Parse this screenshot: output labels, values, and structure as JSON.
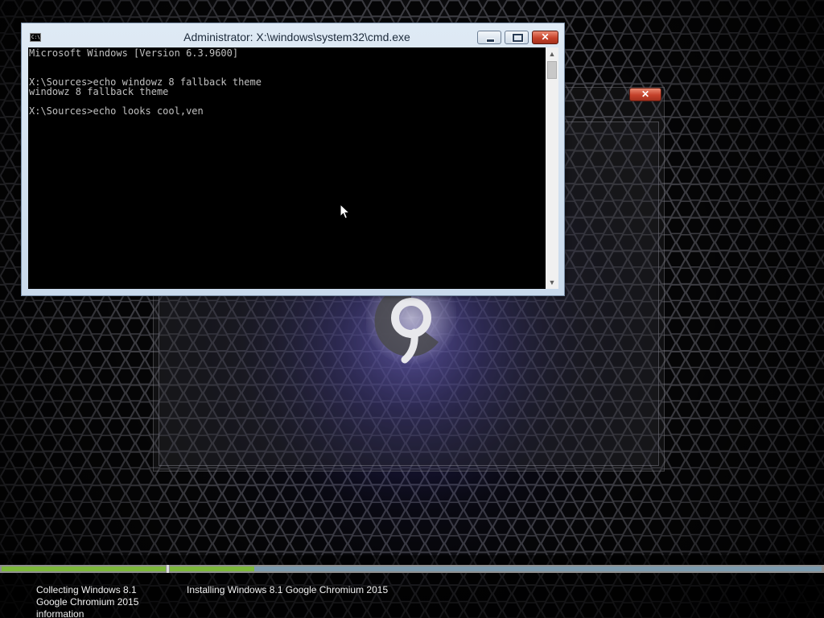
{
  "cmd_window": {
    "title": "Administrator: X:\\windows\\system32\\cmd.exe",
    "icon": "cmd-icon",
    "icon_text": "C:\\",
    "controls": {
      "minimize": "minimize-icon",
      "maximize": "maximize-icon",
      "close": "✕"
    },
    "console_lines": [
      "Microsoft Windows [Version 6.3.9600]",
      "",
      "",
      "X:\\Sources>echo windowz 8 fallback theme",
      "windowz 8 fallback theme",
      "",
      "X:\\Sources>echo looks cool,ven"
    ],
    "colors": {
      "console_bg": "#000000",
      "console_text": "#c0c0c0"
    }
  },
  "setup_dialog": {
    "close_label": "✕",
    "logo": "chromium-logo"
  },
  "setup_progress": {
    "steps": [
      {
        "label": "Collecting Windows 8.1 Google Chromium 2015 information",
        "progress": 1.0
      },
      {
        "label": "Installing Windows 8.1 Google Chromium 2015",
        "progress": 0.13
      }
    ],
    "colors": {
      "fill": "#7cb83a",
      "track": "#7c9aad"
    }
  },
  "desktop": {
    "background": "hexagon-mesh",
    "glow_color": "#6a5ce0"
  }
}
